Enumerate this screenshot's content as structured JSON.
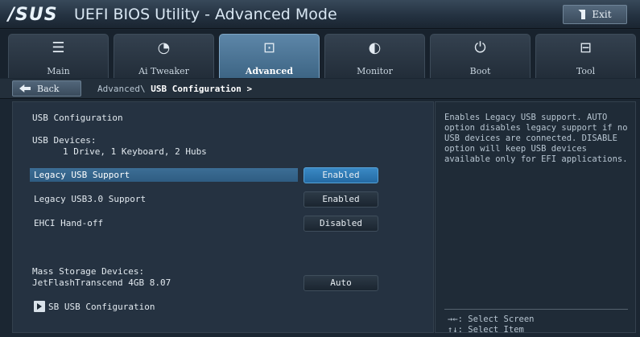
{
  "header": {
    "logo": "/SUS",
    "title": "UEFI BIOS Utility - Advanced Mode",
    "exit_label": "Exit"
  },
  "tabs": [
    {
      "label": "Main",
      "icon": "list-icon"
    },
    {
      "label": "Ai Tweaker",
      "icon": "tweaker-icon"
    },
    {
      "label": "Advanced",
      "icon": "advanced-icon"
    },
    {
      "label": "Monitor",
      "icon": "monitor-icon"
    },
    {
      "label": "Boot",
      "icon": "power-icon"
    },
    {
      "label": "Tool",
      "icon": "tool-icon"
    }
  ],
  "active_tab": "Advanced",
  "breadcrumb": {
    "back_label": "Back",
    "path": "Advanced\\",
    "current": "USB Configuration >"
  },
  "main": {
    "section_title": "USB Configuration",
    "usb_devices_label": "USB Devices:",
    "usb_devices_value": "1 Drive, 1 Keyboard, 2 Hubs",
    "settings": [
      {
        "label": "Legacy USB Support",
        "value": "Enabled",
        "selected": true
      },
      {
        "label": "Legacy USB3.0 Support",
        "value": "Enabled",
        "selected": false
      },
      {
        "label": "EHCI Hand-off",
        "value": "Disabled",
        "selected": false
      }
    ],
    "mass_storage_label": "Mass Storage Devices:",
    "mass_storage_device": "JetFlashTranscend 4GB 8.07",
    "mass_storage_value": "Auto",
    "submenu_label": "SB USB Configuration"
  },
  "help": {
    "text": "Enables Legacy USB support. AUTO\noption disables legacy support if no\nUSB devices are connected. DISABLE\noption will keep USB devices\navailable only for EFI applications.",
    "hints": [
      {
        "keys": "→←:",
        "action": "Select Screen"
      },
      {
        "keys": "↑↓:",
        "action": "Select Item"
      }
    ]
  },
  "colors": {
    "accent": "#3a89c4",
    "highlight": "#3c6e95",
    "background": "#1b2632"
  }
}
